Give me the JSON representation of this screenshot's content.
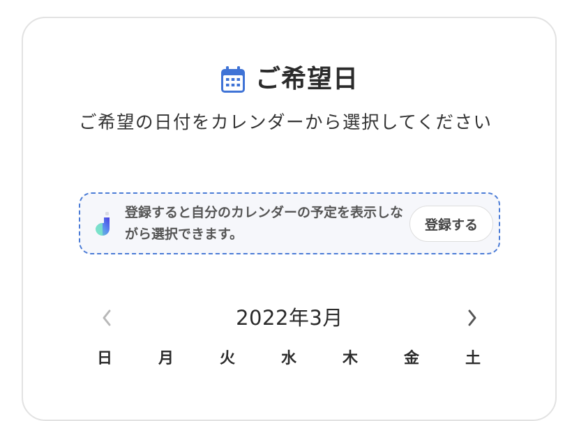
{
  "header": {
    "icon": "calendar-icon",
    "title": "ご希望日",
    "subtitle": "ご希望の日付をカレンダーから選択してください"
  },
  "notice": {
    "logo_icon": "app-logo-icon",
    "text": "登録すると自分のカレンダーの予定を表示しながら選択できます。",
    "button_label": "登録する",
    "colors": {
      "border": "#4a7bd6",
      "background": "#f6f7fb"
    }
  },
  "calendar": {
    "prev_icon": "chevron-left-icon",
    "next_icon": "chevron-right-icon",
    "month_label": "2022年3月",
    "weekdays": [
      "日",
      "月",
      "火",
      "水",
      "木",
      "金",
      "土"
    ]
  },
  "colors": {
    "accent": "#3f73d6",
    "text": "#2b2b2b",
    "card_border": "#e2e2e2"
  }
}
